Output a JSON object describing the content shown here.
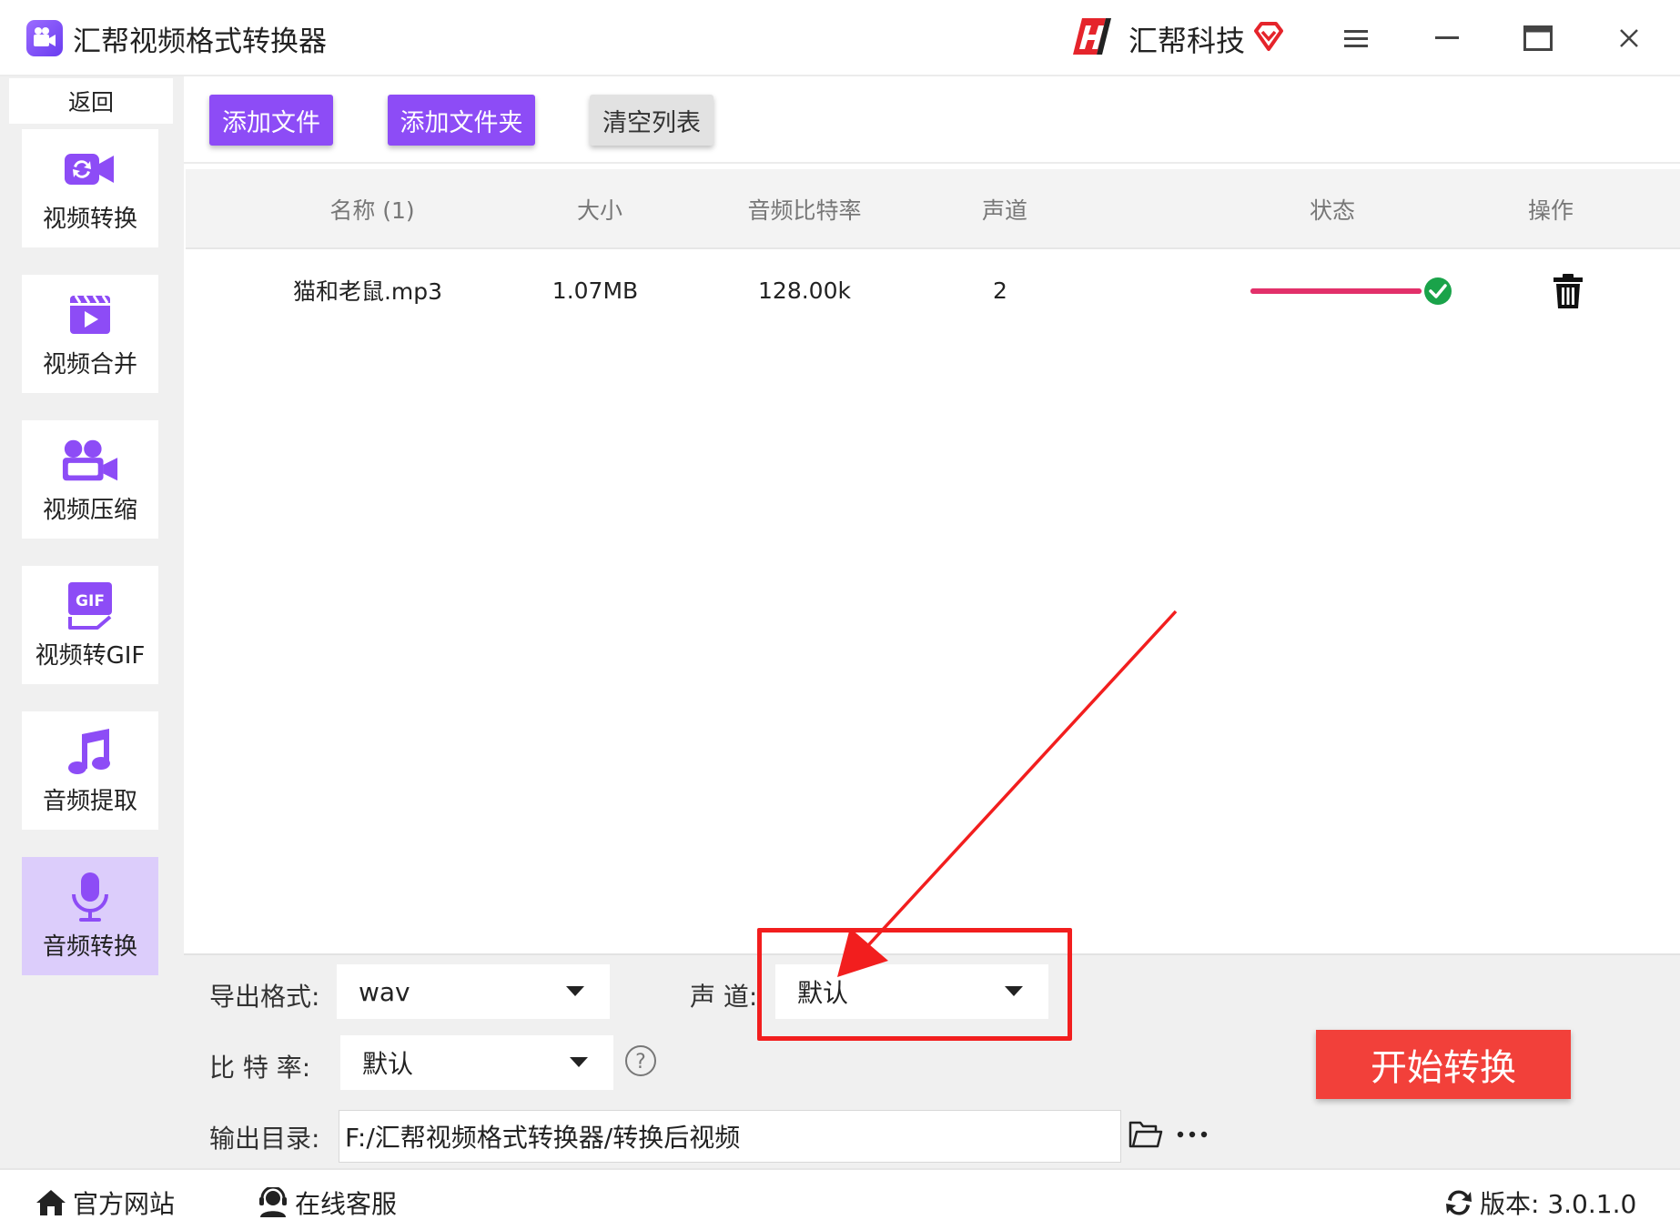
{
  "window": {
    "title": "汇帮视频格式转换器",
    "brand": "汇帮科技",
    "icons": [
      "app-logo-icon",
      "brand-logo-icon",
      "vip-diamond-icon",
      "menu-icon",
      "minimize-icon",
      "maximize-icon",
      "close-icon"
    ]
  },
  "sidebar": {
    "back_label": "返回",
    "items": [
      {
        "label": "视频转换",
        "icon": "video-convert-icon",
        "active": false
      },
      {
        "label": "视频合并",
        "icon": "video-merge-icon",
        "active": false
      },
      {
        "label": "视频压缩",
        "icon": "video-compress-icon",
        "active": false
      },
      {
        "label": "视频转GIF",
        "icon": "gif-icon",
        "active": false
      },
      {
        "label": "音频提取",
        "icon": "music-note-icon",
        "active": false
      },
      {
        "label": "音频转换",
        "icon": "microphone-icon",
        "active": true
      }
    ]
  },
  "toolbar": {
    "add_file": "添加文件",
    "add_folder": "添加文件夹",
    "clear_list": "清空列表"
  },
  "table": {
    "headers": [
      "名称 (1)",
      "大小",
      "音频比特率",
      "声道",
      "状态",
      "操作"
    ],
    "rows": [
      {
        "name": "猫和老鼠.mp3",
        "size": "1.07MB",
        "bitrate": "128.00k",
        "channels": "2",
        "progress": 1.0,
        "status_icon": "check-circle-icon",
        "action_icon": "trash-icon"
      }
    ]
  },
  "settings": {
    "format_label": "导出格式:",
    "format_value": "wav",
    "channel_label": "声 道:",
    "channel_value": "默认",
    "bitrate_label": "比 特 率:",
    "bitrate_value": "默认",
    "output_label": "输出目录:",
    "output_path": "F:/汇帮视频格式转换器/转换后视频",
    "start_button": "开始转换"
  },
  "footer": {
    "website": "官方网站",
    "support": "在线客服",
    "version": "版本:  3.0.1.0"
  },
  "colors": {
    "accent": "#8d4cf6",
    "active_nav": "#dccdfb",
    "start": "#f2403a",
    "progress": "#e2306a",
    "success": "#1aa34a",
    "annotation": "#f21e1e"
  }
}
